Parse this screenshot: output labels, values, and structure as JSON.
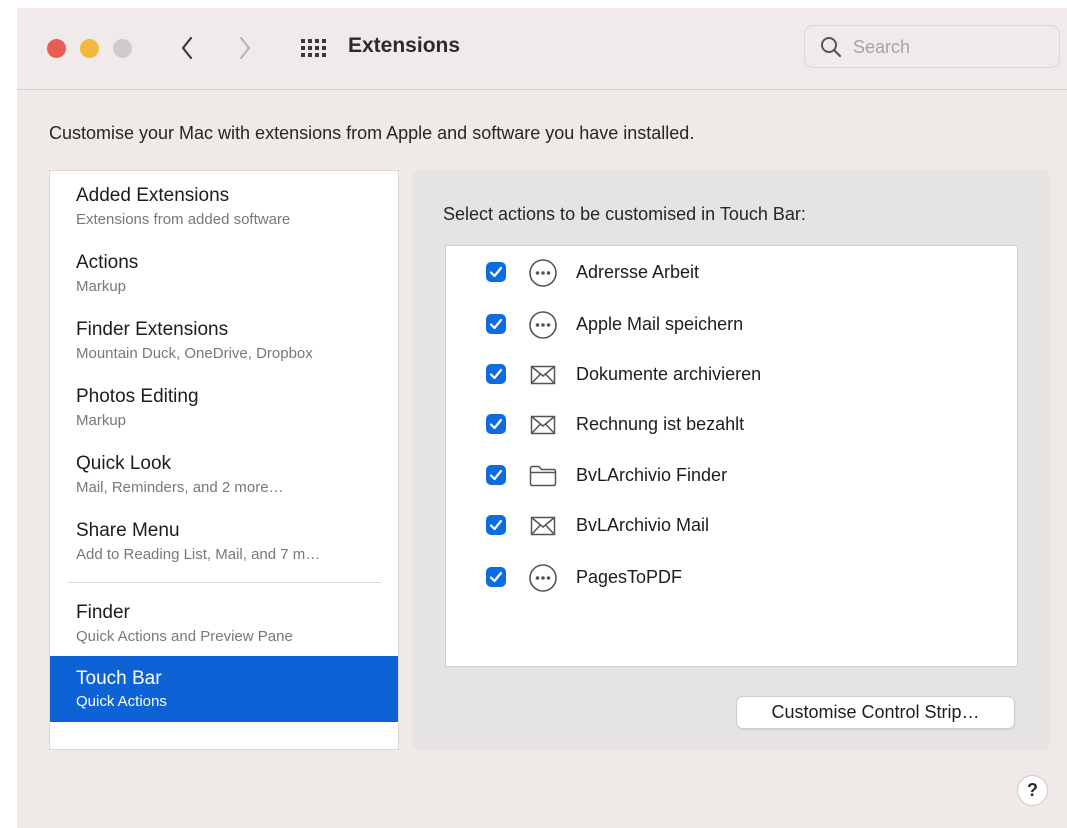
{
  "window": {
    "title": "Extensions",
    "traffic_lights": {
      "close": "#ec5b53",
      "minimize": "#f4b93a",
      "zoom": "#cfcbca"
    }
  },
  "toolbar": {
    "back_icon": "chevron-left-icon",
    "forward_icon": "chevron-right-icon",
    "grid_icon": "grid-icon",
    "search_placeholder": "Search",
    "search_value": ""
  },
  "description": "Customise your Mac with extensions from Apple and software you have installed.",
  "sidebar": {
    "items": [
      {
        "title": "Added Extensions",
        "subtitle": "Extensions from added software",
        "selected": false
      },
      {
        "title": "Actions",
        "subtitle": "Markup",
        "selected": false
      },
      {
        "title": "Finder Extensions",
        "subtitle": "Mountain Duck, OneDrive, Dropbox",
        "selected": false
      },
      {
        "title": "Photos Editing",
        "subtitle": "Markup",
        "selected": false
      },
      {
        "title": "Quick Look",
        "subtitle": "Mail, Reminders, and 2 more…",
        "selected": false
      },
      {
        "title": "Share Menu",
        "subtitle": "Add to Reading List, Mail, and 7 m…",
        "selected": false
      },
      {
        "title": "Finder",
        "subtitle": "Quick Actions and Preview Pane",
        "selected": false
      },
      {
        "title": "Touch Bar",
        "subtitle": "Quick Actions",
        "selected": true
      }
    ],
    "selected_color": "#0d62d6"
  },
  "panel": {
    "title": "Select actions to be customised in Touch Bar:",
    "actions": [
      {
        "label": "Adrersse Arbeit",
        "checked": true,
        "icon": "ellipsis-circle-icon"
      },
      {
        "label": "Apple Mail speichern",
        "checked": true,
        "icon": "ellipsis-circle-icon"
      },
      {
        "label": "Dokumente archivieren",
        "checked": true,
        "icon": "envelope-icon"
      },
      {
        "label": "Rechnung ist bezahlt",
        "checked": true,
        "icon": "envelope-icon"
      },
      {
        "label": "BvLArchivio Finder",
        "checked": true,
        "icon": "folder-icon"
      },
      {
        "label": "BvLArchivio Mail",
        "checked": true,
        "icon": "envelope-icon"
      },
      {
        "label": "PagesToPDF",
        "checked": true,
        "icon": "ellipsis-circle-icon"
      }
    ],
    "customise_button": "Customise Control Strip…",
    "checkbox_color": "#0d6de0"
  },
  "help_label": "?"
}
